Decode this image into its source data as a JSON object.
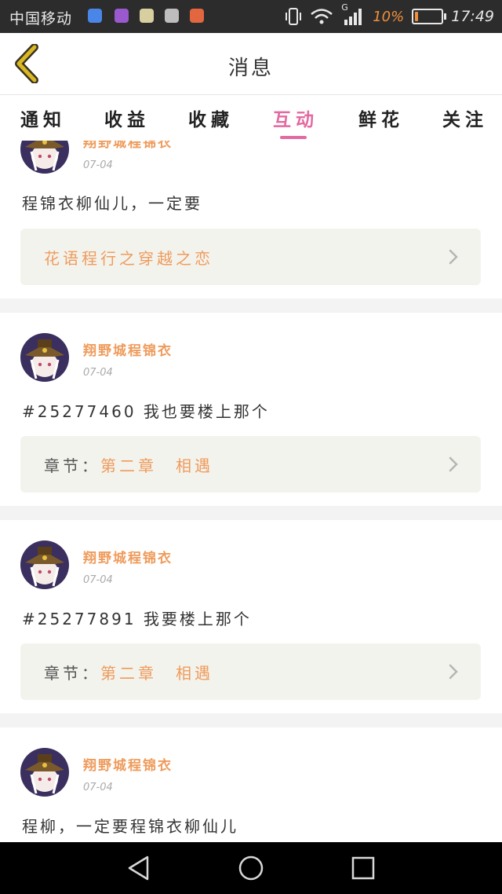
{
  "status_bar": {
    "carrier": "中国移动",
    "time": "17:49",
    "battery_percent_label": "10%",
    "battery_level": 0.1,
    "network_label": "G",
    "app_icon_colors": [
      "#4a86e8",
      "#9b59d0",
      "#d8cfa0",
      "#bdbdbd",
      "#e2663f"
    ]
  },
  "header": {
    "title": "消息",
    "back_icon": "chevron-left-icon",
    "accent": "#c6a21a"
  },
  "tabs": {
    "items": [
      {
        "label": "通知"
      },
      {
        "label": "收益"
      },
      {
        "label": "收藏"
      },
      {
        "label": "互动",
        "active": true
      },
      {
        "label": "鲜花"
      },
      {
        "label": "关注"
      }
    ],
    "active_color": "#e36aa1"
  },
  "feed": {
    "items": [
      {
        "username": "翔野城程锦衣",
        "date": "07-04",
        "message": "程锦衣柳仙儿，一定要",
        "reference": {
          "label": "",
          "value": "花语程行之穿越之恋"
        }
      },
      {
        "username": "翔野城程锦衣",
        "date": "07-04",
        "message": "#25277460 我也要楼上那个",
        "reference": {
          "label": "章节：",
          "value": "第二章　相遇"
        }
      },
      {
        "username": "翔野城程锦衣",
        "date": "07-04",
        "message": "#25277891 我要楼上那个",
        "reference": {
          "label": "章节：",
          "value": "第二章　相遇"
        }
      },
      {
        "username": "翔野城程锦衣",
        "date": "07-04",
        "message": "程柳，一定要程锦衣柳仙儿"
      }
    ],
    "username_color": "#ef9b5b"
  },
  "nav_bar": {
    "back": "triangle-back-icon",
    "home": "circle-home-icon",
    "recents": "square-recents-icon"
  }
}
